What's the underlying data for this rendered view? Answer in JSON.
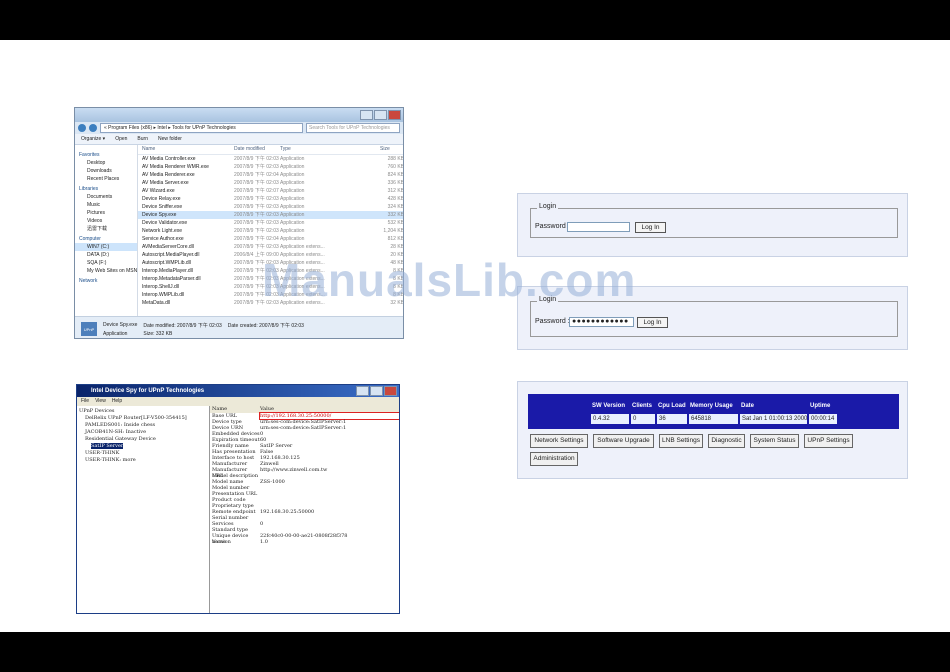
{
  "explorer": {
    "address": "« Program Files (x86) ▸ Intel ▸ Tools for UPnP Technologies",
    "search_placeholder": "Search Tools for UPnP Technologies",
    "toolbar": [
      "Organize ▾",
      "Open",
      "Burn",
      "New folder"
    ],
    "nav": [
      {
        "label": "Favorites",
        "group": true
      },
      {
        "label": "Desktop"
      },
      {
        "label": "Downloads"
      },
      {
        "label": "Recent Places"
      },
      {
        "label": "Libraries",
        "group": true
      },
      {
        "label": "Documents"
      },
      {
        "label": "Music"
      },
      {
        "label": "Pictures"
      },
      {
        "label": "Videos"
      },
      {
        "label": "迅雷下载"
      },
      {
        "label": "Computer",
        "group": true
      },
      {
        "label": "WIN7 (C:)",
        "selected": true
      },
      {
        "label": "DATA (D:)"
      },
      {
        "label": "SQA (F:)"
      },
      {
        "label": "My Web Sites on MSN"
      },
      {
        "label": "Network",
        "group": true
      }
    ],
    "columns": [
      "Name",
      "Date modified",
      "Type",
      "Size"
    ],
    "files": [
      [
        "AV Media Controller.exe",
        "2007/8/9 下午 02:03",
        "Application",
        "288 KB"
      ],
      [
        "AV Media Renderer WMR.exe",
        "2007/8/9 下午 02:03",
        "Application",
        "760 KB"
      ],
      [
        "AV Media Renderer.exe",
        "2007/8/9 下午 02:04",
        "Application",
        "824 KB"
      ],
      [
        "AV Media Server.exe",
        "2007/8/9 下午 02:03",
        "Application",
        "336 KB"
      ],
      [
        "AV Wizard.exe",
        "2007/8/9 下午 02:07",
        "Application",
        "312 KB"
      ],
      [
        "Device Relay.exe",
        "2007/8/9 下午 02:03",
        "Application",
        "428 KB"
      ],
      [
        "Device Sniffer.exe",
        "2007/8/9 下午 02:03",
        "Application",
        "324 KB"
      ],
      [
        "Device Spy.exe",
        "2007/8/9 下午 02:03",
        "Application",
        "332 KB"
      ],
      [
        "Device Validator.exe",
        "2007/8/9 下午 02:03",
        "Application",
        "532 KB"
      ],
      [
        "Network Light.exe",
        "2007/8/9 下午 02:03",
        "Application",
        "1,204 KB"
      ],
      [
        "Service Author.exe",
        "2007/8/9 下午 02:04",
        "Application",
        "812 KB"
      ],
      [
        "AVMediaServerCore.dll",
        "2007/8/9 下午 02:03",
        "Application extens...",
        "28 KB"
      ],
      [
        "Autoscript.MediaPlayer.dll",
        "2006/8/4 上午 09:00",
        "Application extens...",
        "20 KB"
      ],
      [
        "Autoscript.WMPLib.dll",
        "2007/8/9 下午 02:03",
        "Application extens...",
        "48 KB"
      ],
      [
        "Interop.MediaPlayer.dll",
        "2007/8/9 下午 02:03",
        "Application extens...",
        "8 KB"
      ],
      [
        "Interop.MetadataParser.dll",
        "2007/8/9 下午 02:03",
        "Application extens...",
        "8 KB"
      ],
      [
        "Interop.ShellJ.dll",
        "2007/8/9 下午 02:03",
        "Application extens...",
        "8 KB"
      ],
      [
        "Interop.WMPLib.dll",
        "2007/8/9 下午 02:03",
        "Application extens...",
        "8 KB"
      ],
      [
        "MetaData.dll",
        "2007/8/9 下午 02:03",
        "Application extens...",
        "32 KB"
      ]
    ],
    "status": {
      "name": "Device Spy.exe",
      "modified": "Date modified: 2007/8/9 下午 02:03",
      "created": "Date created: 2007/8/9 下午 02:03",
      "type": "Application",
      "size": "Size: 332 KB",
      "logo": "UPnP"
    }
  },
  "spy": {
    "title": "Intel Device Spy for UPnP Technologies",
    "menu": [
      "File",
      "View",
      "Help"
    ],
    "tree": [
      "UPnP Devices",
      "DelRelix UPnP Router[LF-V500-354415]",
      "PAMLEDS001: Inside chess",
      "JACOB41N-SH: Inactive",
      "Residential Gateway Device",
      "SatIP Server",
      "USER-THINK",
      "USER-THINK: more"
    ],
    "prop_head": [
      "Name",
      "Value"
    ],
    "props": [
      [
        "Base URL",
        "http://192.168.30.25:50000/"
      ],
      [
        "Device type",
        "urn:ses-com:device:SatIPServer:1"
      ],
      [
        "Device URN",
        "urn:ses-com:device:SatIPServer:1"
      ],
      [
        "Embedded devices",
        "0"
      ],
      [
        "Expiration timeout",
        "60"
      ],
      [
        "Friendly name",
        "SatIP Server"
      ],
      [
        "Has presentation",
        "False"
      ],
      [
        "Interface to host",
        "192.168.30.125"
      ],
      [
        "Manufacturer",
        "Zinwell"
      ],
      [
        "Manufacturer URL",
        "http://www.zinwell.com.tw"
      ],
      [
        "Model description",
        ""
      ],
      [
        "Model name",
        "ZSS-1000"
      ],
      [
        "Model number",
        ""
      ],
      [
        "Presentation URL",
        ""
      ],
      [
        "Product code",
        ""
      ],
      [
        "Proprietary type",
        ""
      ],
      [
        "Remote endpoint",
        "192.168.30.25:50000"
      ],
      [
        "Serial number",
        ""
      ],
      [
        "Services",
        "0"
      ],
      [
        "Standard type",
        ""
      ],
      [
        "Unique device name",
        "22fc40c0-00-00-ae21-0808f28f378"
      ],
      [
        "Version",
        "1.0"
      ]
    ]
  },
  "login1": {
    "legend": "Login",
    "label": "Password :",
    "value": "",
    "button": "Log In"
  },
  "login2": {
    "legend": "Login",
    "label": "Password :",
    "value": "●●●●●●●●●●●●",
    "button": "Log In"
  },
  "status_table": {
    "headers": [
      "SW Version",
      "Clients",
      "Cpu Load",
      "Memory Usage",
      "Date",
      "Uptime"
    ],
    "values": [
      "0.4.32",
      "0",
      "36",
      "645818",
      "Sat Jan 1 01:00:13 2000",
      "00:00:14"
    ]
  },
  "admin_buttons": [
    "Network Settings",
    "Software Upgrade",
    "LNB Settings",
    "Diagnostic",
    "System Status",
    "UPnP Settings",
    "Administration"
  ],
  "watermark": "ManualsLib.com"
}
